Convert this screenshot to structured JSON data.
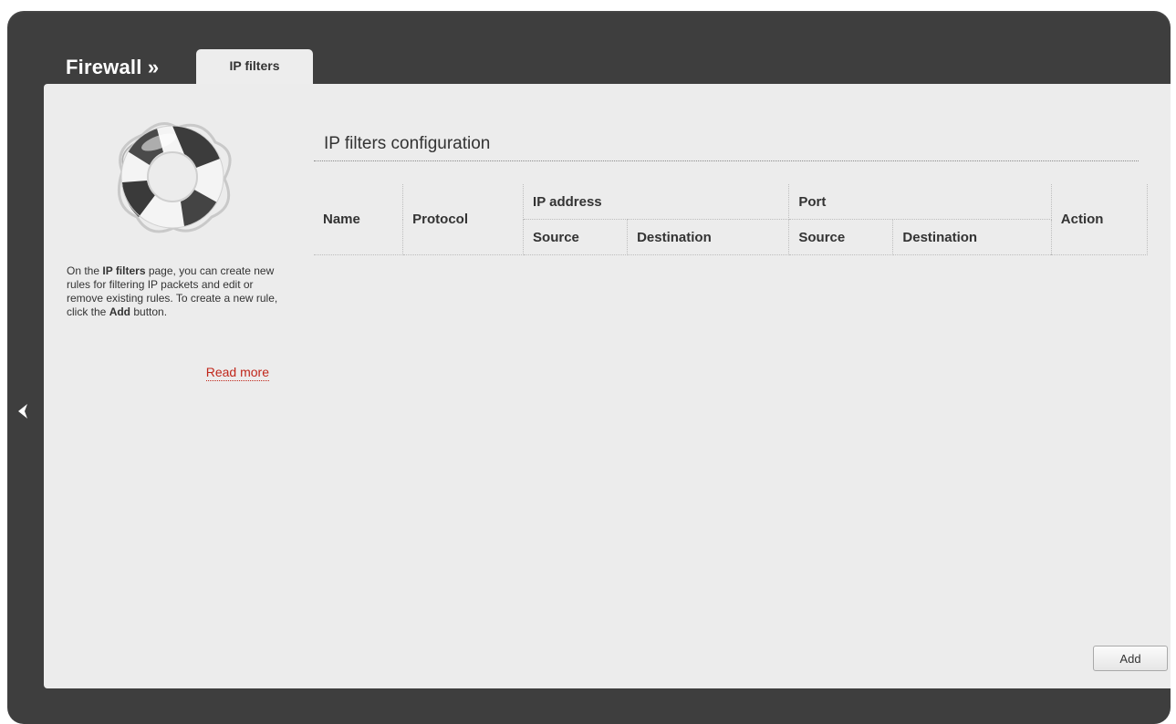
{
  "header": {
    "section_title": "Firewall »",
    "active_tab": "IP filters"
  },
  "help": {
    "icon": "lifebuoy-icon",
    "text_part1": "On the ",
    "text_bold1": "IP filters",
    "text_part2": " page, you can create new rules for filtering IP packets and edit or remove existing rules. To create a new rule, click the ",
    "text_bold2": "Add",
    "text_part3": " button.",
    "read_more": "Read more"
  },
  "main": {
    "title": "IP filters configuration",
    "table": {
      "col_name": "Name",
      "col_protocol": "Protocol",
      "col_ip_address": "IP address",
      "col_port": "Port",
      "col_action": "Action",
      "ip_source": "Source",
      "ip_destination": "Destination",
      "port_source": "Source",
      "port_destination": "Destination",
      "rows": []
    },
    "add_button": "Add"
  },
  "nav": {
    "back_icon": "chevron-left-icon"
  },
  "colors": {
    "frame": "#3e3e3e",
    "panel": "#ececec",
    "link": "#c0271b",
    "text": "#333333"
  }
}
